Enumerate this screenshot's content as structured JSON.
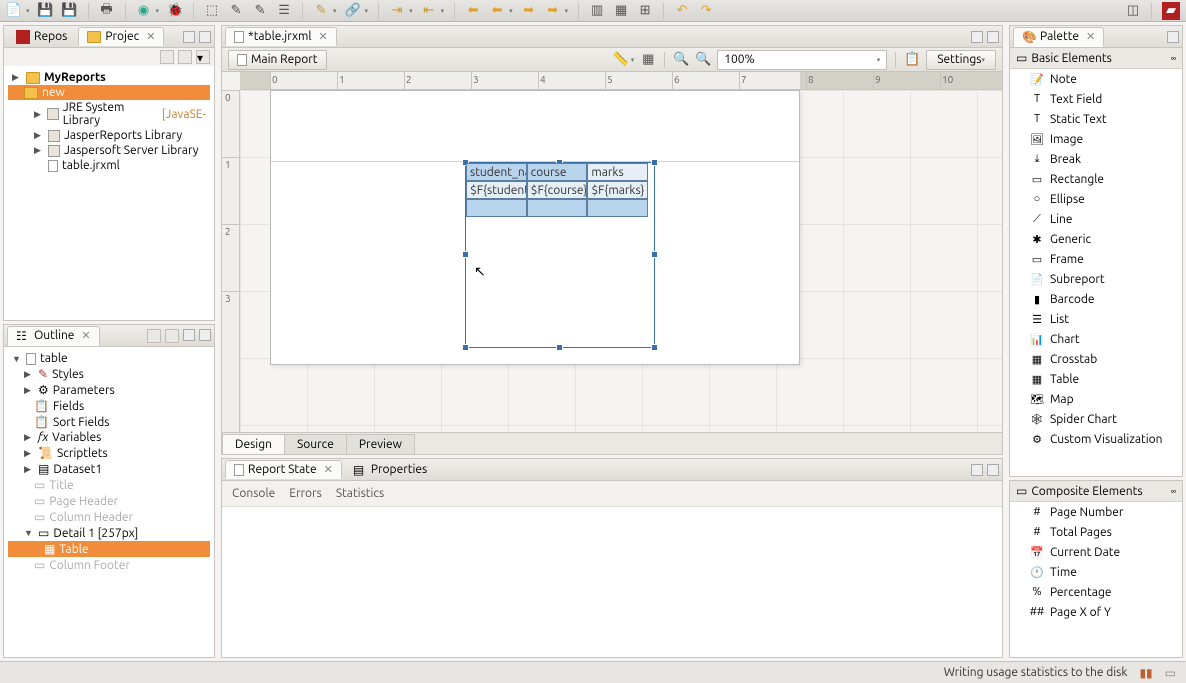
{
  "toolbar_icons": [
    "new",
    "save",
    "save-all",
    "print",
    "build",
    "add",
    "bug",
    "undo",
    "redo",
    "pencil",
    "list",
    "connect",
    "dropdown1",
    "dropdown2",
    "back",
    "back-menu",
    "fwd",
    "fwd-menu",
    "layout1",
    "layout2",
    "layout3",
    "rotl",
    "rotr"
  ],
  "left": {
    "repos_tab": "Repos",
    "project_tab": "Projec",
    "root": "MyReports",
    "new_folder": "new",
    "libs": [
      "JRE System Library",
      "JasperReports Library",
      "Jaspersoft Server Library"
    ],
    "lib_suffix": "[JavaSE-",
    "file": "table.jrxml",
    "outline_tab": "Outline",
    "outline_root": "table",
    "outline_items": [
      "Styles",
      "Parameters",
      "Fields",
      "Sort Fields",
      "Variables",
      "Scriptlets",
      "Dataset1",
      "Title",
      "Page Header",
      "Column Header"
    ],
    "detail": "Detail 1 [257px]",
    "detail_child": "Table",
    "col_footer": "Column Footer"
  },
  "editor": {
    "file_tab": "*table.jrxml",
    "main_report_btn": "Main Report",
    "zoom": "100%",
    "settings": "Settings",
    "tabs": [
      "Design",
      "Source",
      "Preview"
    ],
    "ruler_nums": [
      "0",
      "1",
      "2",
      "3",
      "4",
      "5",
      "6",
      "7",
      "8",
      "9",
      "10"
    ],
    "ruler_v": [
      "0",
      "1",
      "2",
      "3"
    ],
    "table_headers": [
      "student_name",
      "course",
      "marks"
    ],
    "table_fields": [
      "$F{student_na",
      "$F{course}",
      "$F{marks}"
    ]
  },
  "bottom": {
    "report_state_tab": "Report State",
    "properties_tab": "Properties",
    "console_tabs": [
      "Console",
      "Errors",
      "Statistics"
    ]
  },
  "palette": {
    "title": "Palette",
    "section1": "Basic Elements",
    "items1": [
      "Note",
      "Text Field",
      "Static Text",
      "Image",
      "Break",
      "Rectangle",
      "Ellipse",
      "Line",
      "Generic",
      "Frame",
      "Subreport",
      "Barcode",
      "List",
      "Chart",
      "Crosstab",
      "Table",
      "Map",
      "Spider Chart",
      "Custom Visualization"
    ],
    "section2": "Composite Elements",
    "items2": [
      "Page Number",
      "Total Pages",
      "Current Date",
      "Time",
      "Percentage",
      "Page X of Y"
    ]
  },
  "status": "Writing usage statistics to the disk"
}
